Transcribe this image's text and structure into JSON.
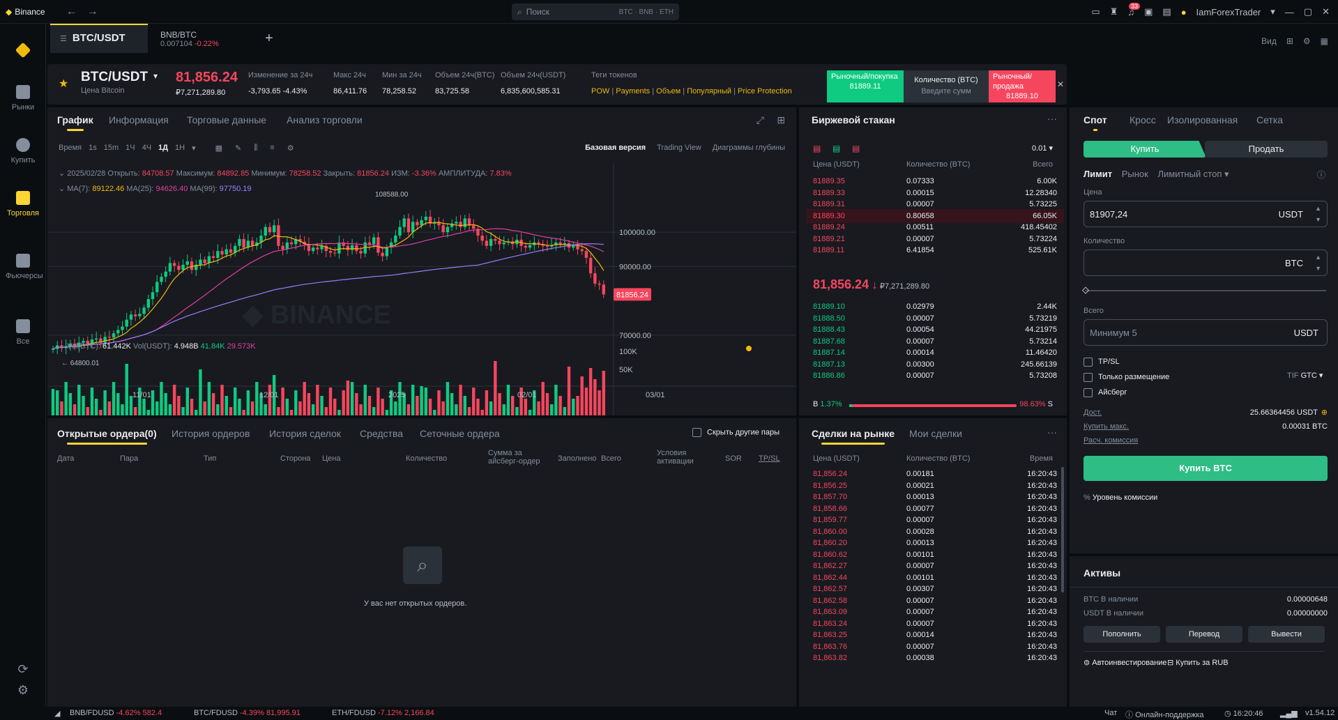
{
  "titlebar": {
    "app": "Binance",
    "search_placeholder": "Поиск",
    "search_pills": "BTC · BNB · ETH",
    "notif_count": "33",
    "user": "IamForexTrader"
  },
  "nav": [
    {
      "label": "Рынки",
      "icon": "markets-icon"
    },
    {
      "label": "Купить",
      "icon": "buy-icon"
    },
    {
      "label": "Торговля",
      "icon": "trade-icon"
    },
    {
      "label": "Фьючерсы",
      "icon": "futures-icon"
    },
    {
      "label": "Все",
      "icon": "all-icon"
    }
  ],
  "tabs": [
    {
      "pair": "BTC/USDT"
    },
    {
      "pair": "BNB/BTC",
      "price": "0.007104",
      "change": "-0.22%"
    }
  ],
  "view_label": "Вид",
  "ticker": {
    "pair": "BTC/USDT",
    "sub": "Цена Bitcoin",
    "price": "81,856.24",
    "price_rub": "₽7,271,289.80",
    "stats": [
      {
        "label": "Изменение за 24ч",
        "value": "-3,793.65 -4.43%"
      },
      {
        "label": "Макс 24ч",
        "value": "86,411.76"
      },
      {
        "label": "Мин за 24ч",
        "value": "78,258.52"
      },
      {
        "label": "Объем 24ч(BTC)",
        "value": "83,725.58"
      },
      {
        "label": "Объем 24ч(USDT)",
        "value": "6,835,600,585.31"
      }
    ],
    "tags_label": "Теги токенов",
    "tags": [
      "POW",
      "Payments",
      "Объем",
      "Популярный",
      "Price Protection"
    ]
  },
  "quick": {
    "buy_label": "Рыночный/покупка",
    "buy_price": "81889.11",
    "qty_label": "Количество (BTC)",
    "qty_placeholder": "Введите сумм",
    "sell_label": "Рыночный/продажа",
    "sell_price": "81889.10"
  },
  "chart_tabs": [
    "График",
    "Информация",
    "Торговые данные",
    "Анализ торговли"
  ],
  "chart_toolbar": {
    "time_label": "Время",
    "intervals": [
      "1s",
      "15m",
      "1Ч",
      "4Ч",
      "1Д",
      "1Н"
    ],
    "active": "1Д",
    "versions": [
      "Базовая версия",
      "Trading View",
      "Диаграммы глубины"
    ]
  },
  "ohlc": {
    "date": "2025/02/28",
    "open_label": "Открыть:",
    "open": "84708.57",
    "high_label": "Максимум:",
    "high": "84892.85",
    "low_label": "Минимум:",
    "low": "78258.52",
    "close_label": "Закрыть:",
    "close": "81856.24",
    "chg_label": "ИЗМ:",
    "chg": "-3.36%",
    "amp_label": "АМПЛИТУДА:",
    "amp": "7.83%"
  },
  "ma": {
    "ma7": "89122.46",
    "ma25": "94626.40",
    "ma99": "97750.19"
  },
  "vol": {
    "btc": "61.442K",
    "usdt": "4.948B",
    "v1": "41.84K",
    "v2": "29.573K"
  },
  "chart_data": {
    "type": "candlestick",
    "x_ticks": [
      "11/01",
      "12/01",
      "2025",
      "02/01",
      "03/01"
    ],
    "y_ticks": [
      "100000.00",
      "90000.00",
      "70000.00"
    ],
    "last_price": "81856.24",
    "hi_label": "108588.00",
    "lo_label": "64800.01",
    "vol_ticks": [
      "100K",
      "50K"
    ],
    "closes": [
      66000,
      67000,
      66200,
      66800,
      67500,
      66500,
      67800,
      68300,
      67500,
      68700,
      69000,
      67800,
      69500,
      69300,
      70500,
      71500,
      72500,
      74500,
      76000,
      75500,
      76200,
      78000,
      80500,
      82500,
      85500,
      87000,
      88500,
      91000,
      90200,
      89000,
      90500,
      91500,
      89000,
      90500,
      92000,
      91000,
      93000,
      92500,
      94500,
      93500,
      95000,
      94000,
      96000,
      98000,
      95500,
      97500,
      96000,
      97000,
      99000,
      101500,
      100000,
      102000,
      96000,
      95000,
      97000,
      96500,
      98000,
      97200,
      96500,
      94500,
      95500,
      95000,
      96000,
      94500,
      94000,
      93800,
      97000,
      96000,
      94800,
      96200,
      94500,
      93800,
      97000,
      96500,
      98500,
      94000,
      93000,
      95500,
      97000,
      99000,
      101500,
      104000,
      100000,
      103000,
      102000,
      103500,
      104500,
      102500,
      103000,
      102000,
      100000,
      101500,
      102500,
      103000,
      101500,
      104000,
      102000,
      101000,
      99000,
      97500,
      96000,
      98000,
      97500,
      96500,
      97000,
      97300,
      96500,
      97800,
      96000,
      95500,
      96200,
      97000,
      96500,
      96000,
      95800,
      96200,
      97000,
      96500,
      96800,
      95500,
      96100,
      95000,
      94500,
      92500,
      88000,
      85000,
      84700,
      81856
    ]
  },
  "orders_tabs": [
    "Открытые ордера(0)",
    "История ордеров",
    "История сделок",
    "Средства",
    "Сеточные ордера"
  ],
  "hide_pairs": "Скрыть другие пары",
  "order_cols": [
    "Дата",
    "Пара",
    "Тип",
    "Сторона",
    "Цена",
    "Количество",
    "Сумма за айсберг-ордер",
    "Заполнено",
    "Всего",
    "Условия активации",
    "SOR",
    "TP/SL"
  ],
  "no_orders": "У вас нет открытых ордеров.",
  "orderbook": {
    "title": "Биржевой стакан",
    "step": "0.01",
    "cols": [
      "Цена (USDT)",
      "Количество (BTC)",
      "Всего"
    ],
    "asks": [
      [
        "81889.35",
        "0.07333",
        "6.00K"
      ],
      [
        "81889.33",
        "0.00015",
        "12.28340"
      ],
      [
        "81889.31",
        "0.00007",
        "5.73225"
      ],
      [
        "81889.30",
        "0.80658",
        "66.05K"
      ],
      [
        "81889.24",
        "0.00511",
        "418.45402"
      ],
      [
        "81889.21",
        "0.00007",
        "5.73224"
      ],
      [
        "81889.11",
        "6.41854",
        "525.61K"
      ]
    ],
    "mid": "81,856.24",
    "mid_rub": "₽7,271,289.80",
    "bids": [
      [
        "81889.10",
        "0.02979",
        "2.44K"
      ],
      [
        "81888.50",
        "0.00007",
        "5.73219"
      ],
      [
        "81888.43",
        "0.00054",
        "44.21975"
      ],
      [
        "81887.68",
        "0.00007",
        "5.73214"
      ],
      [
        "81887.14",
        "0.00014",
        "11.46420"
      ],
      [
        "81887.13",
        "0.00300",
        "245.66139"
      ],
      [
        "81886.86",
        "0.00007",
        "5.73208"
      ]
    ],
    "b_pct": "1.37%",
    "s_pct": "98.63%"
  },
  "trades": {
    "tabs": [
      "Сделки на рынке",
      "Мои сделки"
    ],
    "cols": [
      "Цена (USDT)",
      "Количество (BTC)",
      "Время"
    ],
    "rows": [
      [
        "81,856.24",
        "0.00181",
        "16:20:43"
      ],
      [
        "81,856.25",
        "0.00021",
        "16:20:43"
      ],
      [
        "81,857.70",
        "0.00013",
        "16:20:43"
      ],
      [
        "81,858.66",
        "0.00077",
        "16:20:43"
      ],
      [
        "81,859.77",
        "0.00007",
        "16:20:43"
      ],
      [
        "81,860.00",
        "0.00028",
        "16:20:43"
      ],
      [
        "81,860.20",
        "0.00013",
        "16:20:43"
      ],
      [
        "81,860.62",
        "0.00101",
        "16:20:43"
      ],
      [
        "81,862.27",
        "0.00007",
        "16:20:43"
      ],
      [
        "81,862.44",
        "0.00101",
        "16:20:43"
      ],
      [
        "81,862.57",
        "0.00307",
        "16:20:43"
      ],
      [
        "81,862.58",
        "0.00007",
        "16:20:43"
      ],
      [
        "81,863.09",
        "0.00007",
        "16:20:43"
      ],
      [
        "81,863.24",
        "0.00007",
        "16:20:43"
      ],
      [
        "81,863.25",
        "0.00014",
        "16:20:43"
      ],
      [
        "81,863.76",
        "0.00007",
        "16:20:43"
      ],
      [
        "81,863.82",
        "0.00038",
        "16:20:43"
      ]
    ]
  },
  "form": {
    "tabs": [
      "Спот",
      "Кросс",
      "Изолированная",
      "Сетка"
    ],
    "buy": "Купить",
    "sell": "Продать",
    "types": [
      "Лимит",
      "Рынок",
      "Лимитный стоп"
    ],
    "price_label": "Цена",
    "price": "81907,24",
    "qty_label": "Количество",
    "total_label": "Всего",
    "total_placeholder": "Минимум 5",
    "usdt": "USDT",
    "btc": "BTC",
    "tpsl": "TP/SL",
    "post_only": "Только размещение",
    "iceberg": "Айсберг",
    "tif": "TIF",
    "gtc": "GTC",
    "avail_label": "Дост.",
    "avail": "25.66364456 USDT",
    "max_label": "Купить макс.",
    "max": "0.00031 BTC",
    "fee_calc": "Расч. комиссия",
    "submit": "Купить BTC",
    "fee_level": "Уровень комиссии"
  },
  "assets": {
    "title": "Активы",
    "rows": [
      [
        "BTC В наличии",
        "0.00000648"
      ],
      [
        "USDT В наличии",
        "0.00000000"
      ]
    ],
    "buttons": [
      "Пополнить",
      "Перевод",
      "Вывести"
    ],
    "links": [
      "Автоинвестирование",
      "Купить за RUB"
    ]
  },
  "footer": {
    "tickers": [
      [
        "BNB/FDUSD",
        "-4.62%",
        "582.4"
      ],
      [
        "BTC/FDUSD",
        "-4.39%",
        "81,995.91"
      ],
      [
        "ETH/FDUSD",
        "-7.12%",
        "2,166.84"
      ]
    ],
    "chat": "Чат",
    "support": "Онлайн-поддержка",
    "time": "16:20:46",
    "version": "v1.54.12"
  }
}
